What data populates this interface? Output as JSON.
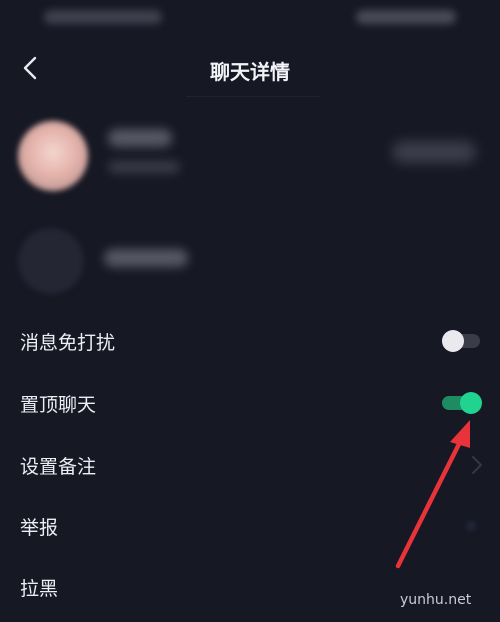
{
  "header": {
    "title": "聊天详情"
  },
  "settings": [
    {
      "label": "消息免打扰",
      "control": "toggle",
      "state": "off"
    },
    {
      "label": "置顶聊天",
      "control": "toggle",
      "state": "on"
    },
    {
      "label": "设置备注",
      "control": "chevron"
    },
    {
      "label": "举报",
      "control": "none"
    },
    {
      "label": "拉黑",
      "control": "none"
    }
  ],
  "colors": {
    "background": "#161824",
    "toggle_on": "#20d38e",
    "annotation_arrow": "#e8333a"
  },
  "watermark": "yunhu.net"
}
